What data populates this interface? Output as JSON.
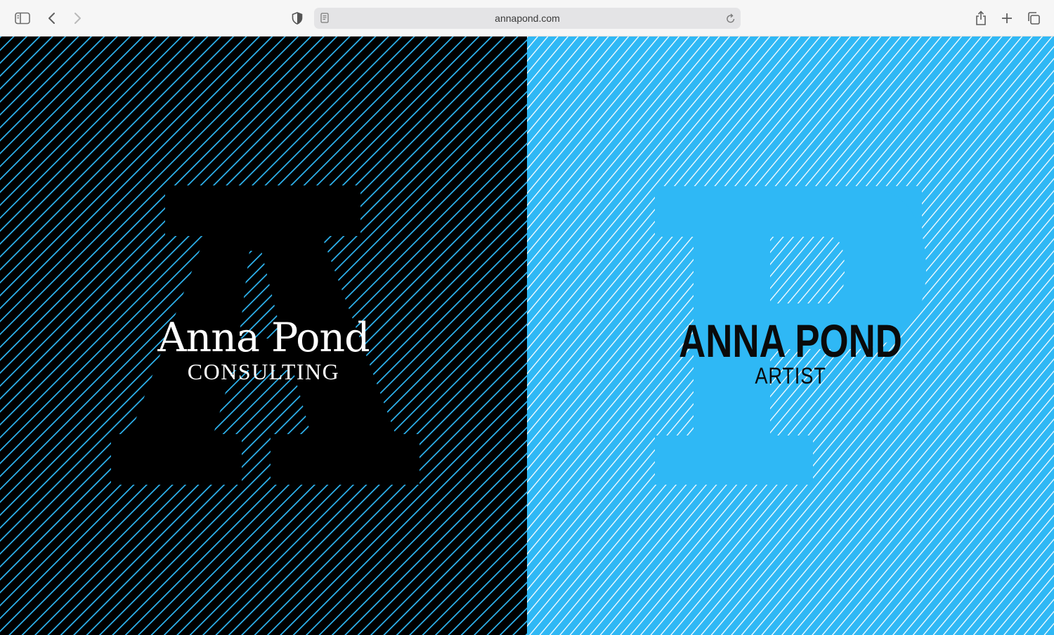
{
  "browser": {
    "url": "annapond.com",
    "icons": {
      "sidebar": "sidebar-icon",
      "back": "chevron-left-icon",
      "forward": "chevron-right-icon",
      "privacy": "shield-icon",
      "reader": "page-icon",
      "reload": "reload-icon",
      "share": "share-icon",
      "new_tab": "plus-icon",
      "tabs": "tabs-overview-icon"
    }
  },
  "left_panel": {
    "name": "Anna Pond",
    "subtitle": "CONSULTING",
    "monogram": "A",
    "background": "#000000",
    "line_color": "#2fb8f5"
  },
  "right_panel": {
    "name": "ANNA POND",
    "subtitle": "ARTIST",
    "monogram": "P",
    "background": "#2fb8f5",
    "line_color": "#ffffff"
  }
}
